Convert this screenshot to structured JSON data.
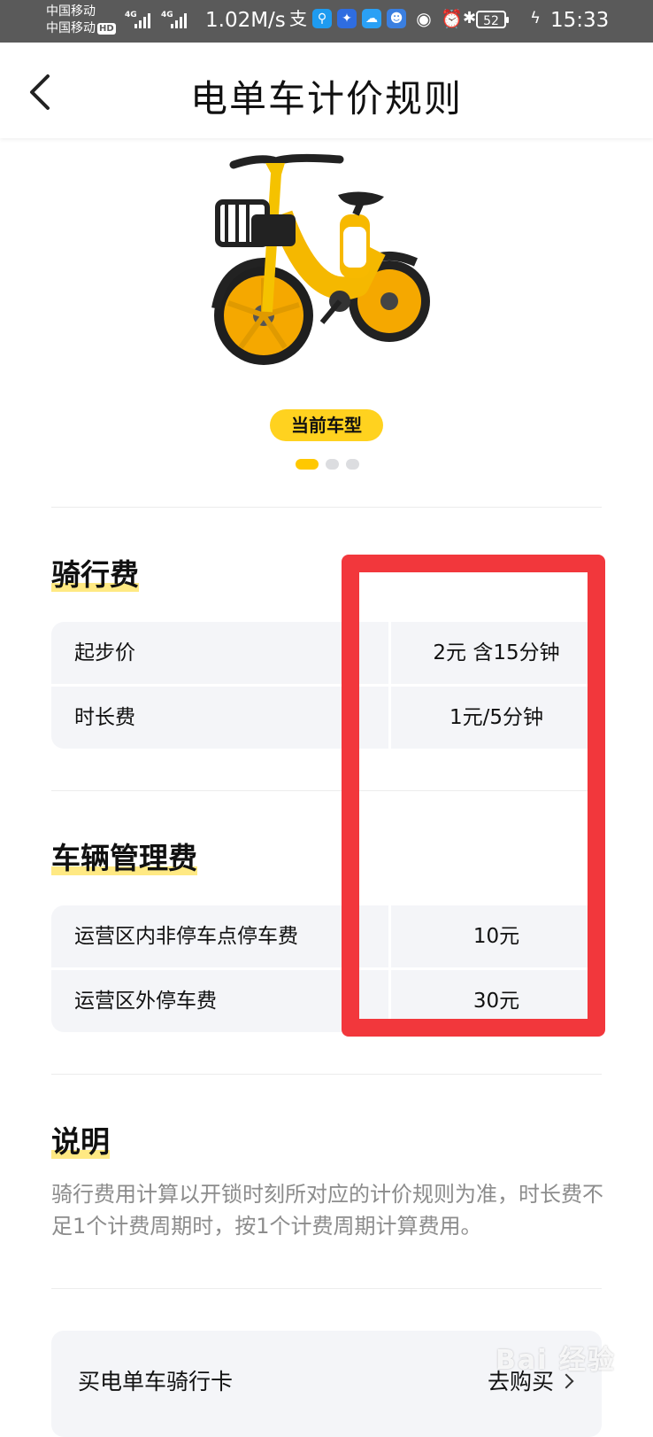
{
  "status_bar": {
    "carrier1": "中国移动",
    "carrier2": "中国移动",
    "hd_badge": "HD",
    "net1": "4G",
    "net2": "4G",
    "speed": "1.02M/s",
    "battery": "52",
    "time": "15:33",
    "icons": [
      "alipay-icon",
      "search-app-icon",
      "bulb-app-icon",
      "weather-app-icon",
      "bot-app-icon",
      "eye-icon",
      "alarm-icon",
      "bluetooth-icon",
      "battery-icon",
      "charging-icon"
    ]
  },
  "header": {
    "back_icon": "chevron-left-icon",
    "title": "电单车计价规则"
  },
  "carousel": {
    "badge": "当前车型",
    "dots": 3,
    "active_index": 0,
    "accent_color": "#ffc800"
  },
  "riding_fee": {
    "title": "骑行费",
    "rows": [
      {
        "label": "起步价",
        "value": "2元 含15分钟"
      },
      {
        "label": "时长费",
        "value": "1元/5分钟"
      }
    ]
  },
  "management_fee": {
    "title": "车辆管理费",
    "rows": [
      {
        "label": "运营区内非停车点停车费",
        "value": "10元"
      },
      {
        "label": "运营区外停车费",
        "value": "30元"
      }
    ]
  },
  "explanation": {
    "title": "说明",
    "text": "骑行费用计算以开锁时刻所对应的计价规则为准，时长费不足1个计费周期时，按1个计费周期计算费用。"
  },
  "card": {
    "label": "买电单车骑行卡",
    "action": "去购买"
  },
  "annotation_color": "#f2373c",
  "watermark": "Bai 经验"
}
